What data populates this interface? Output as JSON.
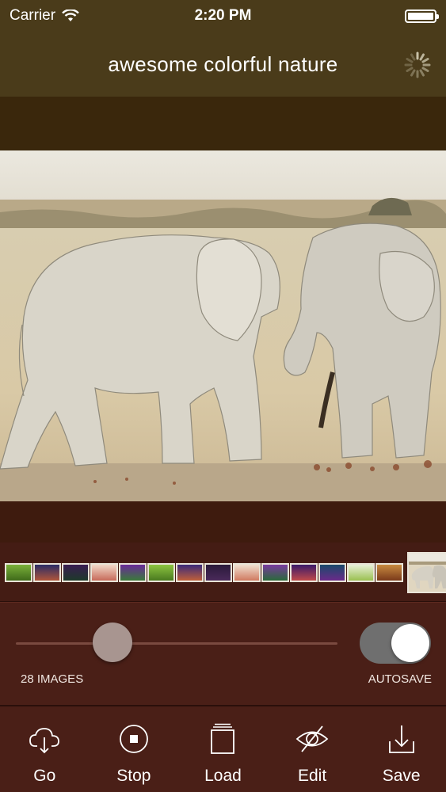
{
  "status_bar": {
    "carrier": "Carrier",
    "time": "2:20 PM"
  },
  "nav": {
    "title": "awesome colorful nature"
  },
  "controls": {
    "images_label": "28 IMAGES",
    "autosave_label": "AUTOSAVE",
    "slider_value": 0.3,
    "autosave_on": true
  },
  "toolbar": {
    "go": "Go",
    "stop": "Stop",
    "load": "Load",
    "edit": "Edit",
    "save": "Save"
  },
  "colors": {
    "nav_bg": "#4a3b1a",
    "panel_bg": "#4a1f17",
    "toggle_on": "#6f6f6f"
  }
}
